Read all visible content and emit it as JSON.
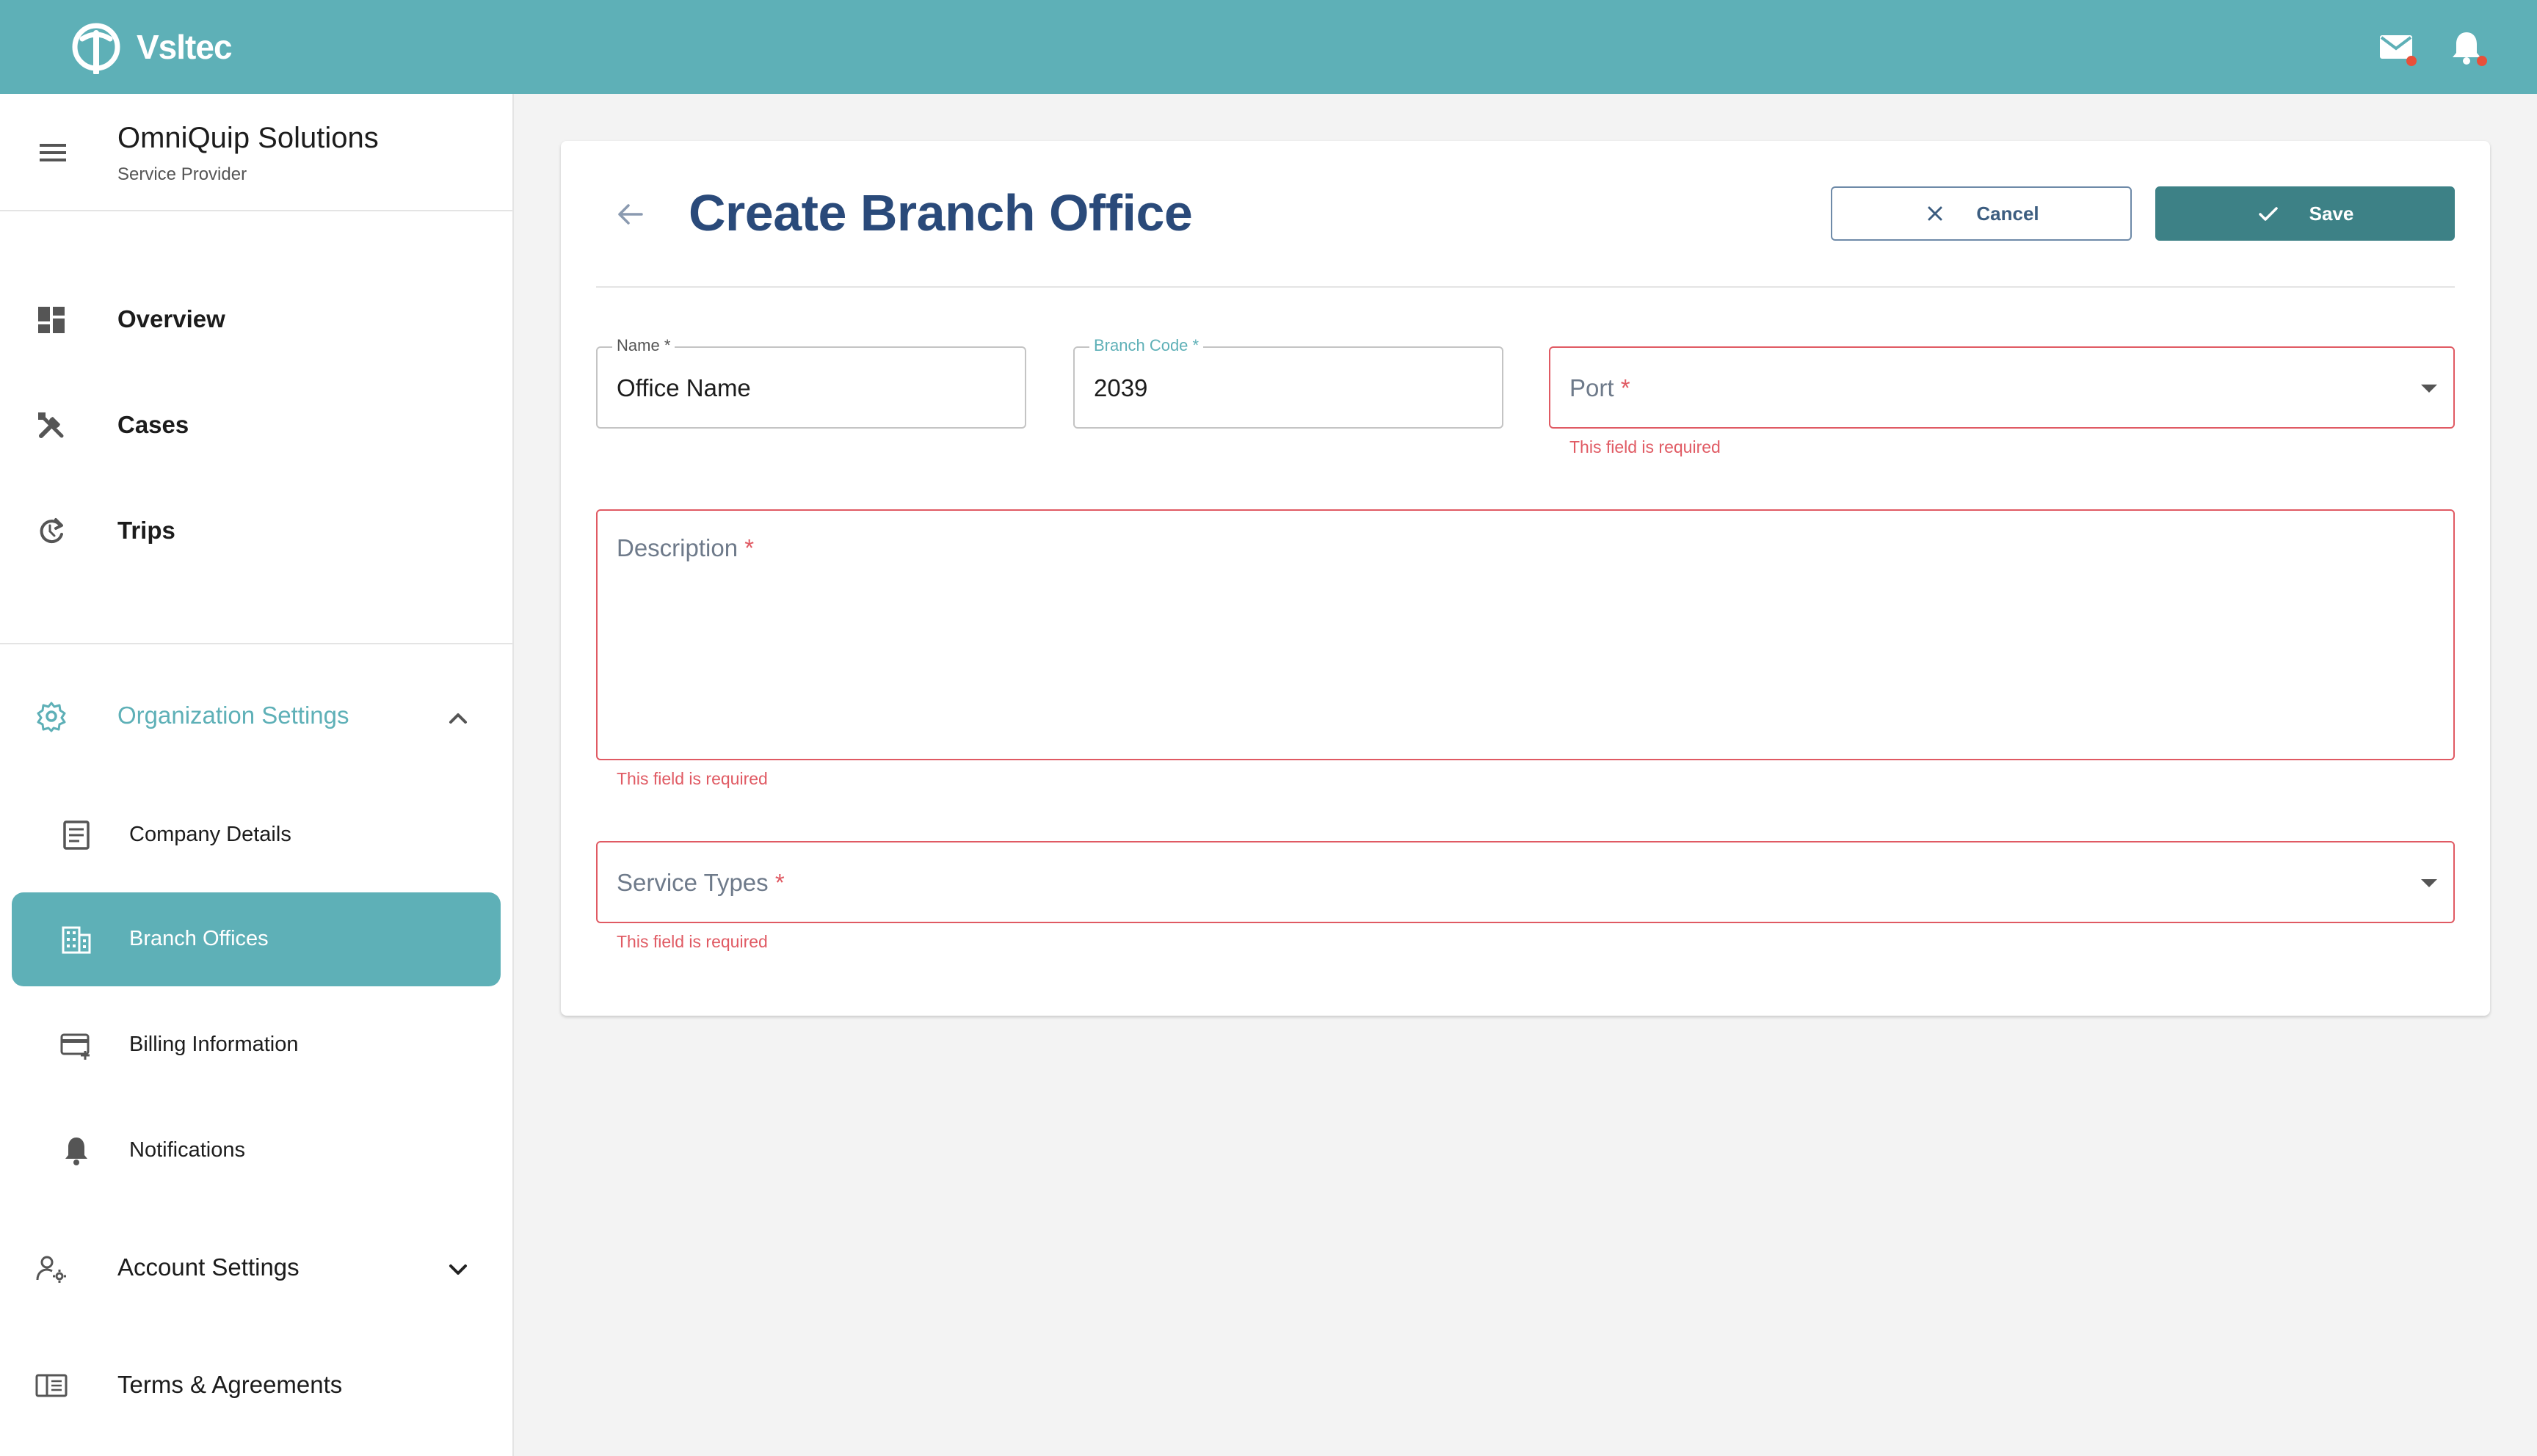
{
  "header": {
    "brand": "Vsltec",
    "icons": [
      "mail-icon",
      "bell-icon"
    ],
    "bg_color": "#5eb0b7"
  },
  "sidebar": {
    "org_name": "OmniQuip Solutions",
    "org_role": "Service Provider",
    "nav": [
      {
        "label": "Overview",
        "icon": "dashboard-icon"
      },
      {
        "label": "Cases",
        "icon": "tools-icon"
      },
      {
        "label": "Trips",
        "icon": "refresh-icon"
      }
    ],
    "org_settings": {
      "label": "Organization Settings",
      "expanded": true,
      "items": [
        {
          "label": "Company Details",
          "icon": "document-icon",
          "active": false
        },
        {
          "label": "Branch Offices",
          "icon": "building-icon",
          "active": true
        },
        {
          "label": "Billing Information",
          "icon": "credit-card-icon",
          "active": false
        },
        {
          "label": "Notifications",
          "icon": "bell-icon",
          "active": false
        }
      ]
    },
    "account_settings": {
      "label": "Account Settings",
      "expanded": false
    },
    "terms": {
      "label": "Terms & Agreements"
    }
  },
  "form": {
    "title": "Create Branch Office",
    "cancel_label": "Cancel",
    "save_label": "Save",
    "fields": {
      "name": {
        "label": "Name",
        "value": "Office Name"
      },
      "branch_code": {
        "label": "Branch Code",
        "value": "2039"
      },
      "port": {
        "label": "Port",
        "error": "This field is required"
      },
      "description": {
        "label": "Description",
        "error": "This field is required"
      },
      "service_types": {
        "label": "Service Types",
        "error": "This field is required"
      }
    },
    "required_mark": "*"
  },
  "colors": {
    "accent": "#5eb0b7",
    "primary_button": "#3d8186",
    "title": "#2a4a7a",
    "error": "#e05a63"
  }
}
